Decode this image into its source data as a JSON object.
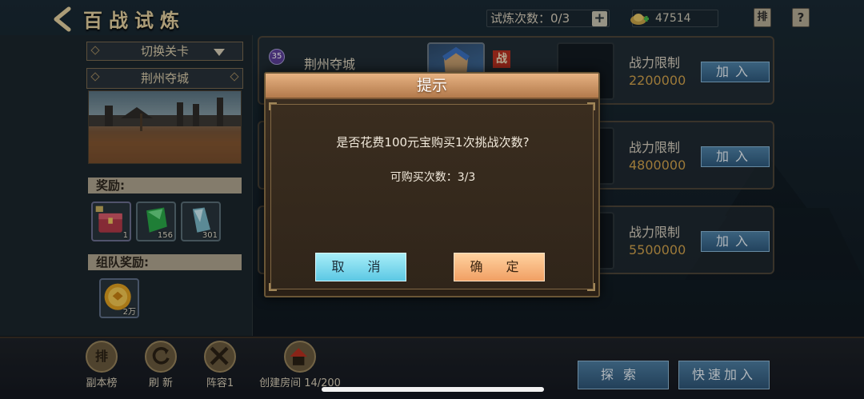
{
  "header": {
    "title": "百战试炼",
    "trial_count_label": "试炼次数：",
    "trial_count_value": "0/3",
    "plus_symbol": "+",
    "gold_amount": "47514",
    "rank_icon_text": "排",
    "help_icon_text": "?"
  },
  "left_panel": {
    "switch_stage_label": "切换关卡",
    "stage_name": "荆州夺城",
    "reward_label": "奖励:",
    "rewards": [
      {
        "icon": "treasure-chest-icon",
        "qty": "1"
      },
      {
        "icon": "green-gem-icon",
        "qty": "156"
      },
      {
        "icon": "crystal-icon",
        "qty": "301"
      }
    ],
    "team_reward_label": "组队奖励:",
    "team_rewards": [
      {
        "icon": "gold-coin-icon",
        "qty": "2万"
      }
    ]
  },
  "cards": [
    {
      "name": "荆州夺城",
      "level": "35",
      "badge": "战",
      "power_label": "战力限制",
      "power_value": "2200000",
      "join_label": "加入"
    },
    {
      "name": "",
      "power_label": "战力限制",
      "power_value": "4800000",
      "join_label": "加入"
    },
    {
      "name": "",
      "power_label": "战力限制",
      "power_value": "5500000",
      "join_label": "加入"
    }
  ],
  "dialog": {
    "title": "提示",
    "message": "是否花费100元宝购买1次挑战次数?",
    "remaining": "可购买次数：3/3",
    "cancel_label": "取 消",
    "confirm_label": "确 定"
  },
  "bottom_bar": {
    "rank_label": "副本榜",
    "rank_icon_text": "排",
    "refresh_label": "刷 新",
    "lineup_label": "阵容1",
    "create_room_label": "创建房间 14/200",
    "explore_label": "探索",
    "quick_join_label": "快速加入"
  },
  "colors": {
    "accent_gold": "#d0a24c",
    "button_blue": "#4f83a8",
    "dialog_header": "#e6b282",
    "cancel_button": "#5cc8e4",
    "confirm_button": "#f1a064"
  }
}
